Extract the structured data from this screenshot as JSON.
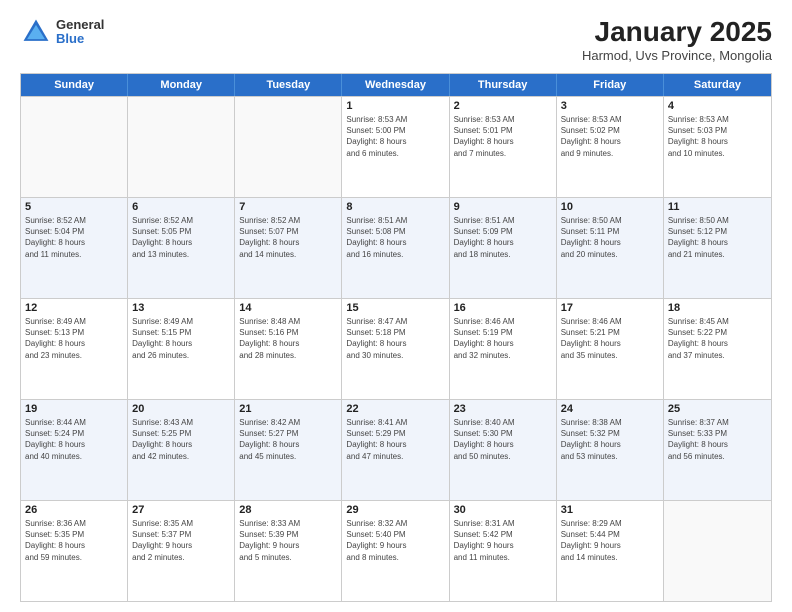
{
  "logo": {
    "general": "General",
    "blue": "Blue"
  },
  "title": "January 2025",
  "subtitle": "Harmod, Uvs Province, Mongolia",
  "headers": [
    "Sunday",
    "Monday",
    "Tuesday",
    "Wednesday",
    "Thursday",
    "Friday",
    "Saturday"
  ],
  "rows": [
    [
      {
        "day": "",
        "lines": []
      },
      {
        "day": "",
        "lines": []
      },
      {
        "day": "",
        "lines": []
      },
      {
        "day": "1",
        "lines": [
          "Sunrise: 8:53 AM",
          "Sunset: 5:00 PM",
          "Daylight: 8 hours",
          "and 6 minutes."
        ]
      },
      {
        "day": "2",
        "lines": [
          "Sunrise: 8:53 AM",
          "Sunset: 5:01 PM",
          "Daylight: 8 hours",
          "and 7 minutes."
        ]
      },
      {
        "day": "3",
        "lines": [
          "Sunrise: 8:53 AM",
          "Sunset: 5:02 PM",
          "Daylight: 8 hours",
          "and 9 minutes."
        ]
      },
      {
        "day": "4",
        "lines": [
          "Sunrise: 8:53 AM",
          "Sunset: 5:03 PM",
          "Daylight: 8 hours",
          "and 10 minutes."
        ]
      }
    ],
    [
      {
        "day": "5",
        "lines": [
          "Sunrise: 8:52 AM",
          "Sunset: 5:04 PM",
          "Daylight: 8 hours",
          "and 11 minutes."
        ]
      },
      {
        "day": "6",
        "lines": [
          "Sunrise: 8:52 AM",
          "Sunset: 5:05 PM",
          "Daylight: 8 hours",
          "and 13 minutes."
        ]
      },
      {
        "day": "7",
        "lines": [
          "Sunrise: 8:52 AM",
          "Sunset: 5:07 PM",
          "Daylight: 8 hours",
          "and 14 minutes."
        ]
      },
      {
        "day": "8",
        "lines": [
          "Sunrise: 8:51 AM",
          "Sunset: 5:08 PM",
          "Daylight: 8 hours",
          "and 16 minutes."
        ]
      },
      {
        "day": "9",
        "lines": [
          "Sunrise: 8:51 AM",
          "Sunset: 5:09 PM",
          "Daylight: 8 hours",
          "and 18 minutes."
        ]
      },
      {
        "day": "10",
        "lines": [
          "Sunrise: 8:50 AM",
          "Sunset: 5:11 PM",
          "Daylight: 8 hours",
          "and 20 minutes."
        ]
      },
      {
        "day": "11",
        "lines": [
          "Sunrise: 8:50 AM",
          "Sunset: 5:12 PM",
          "Daylight: 8 hours",
          "and 21 minutes."
        ]
      }
    ],
    [
      {
        "day": "12",
        "lines": [
          "Sunrise: 8:49 AM",
          "Sunset: 5:13 PM",
          "Daylight: 8 hours",
          "and 23 minutes."
        ]
      },
      {
        "day": "13",
        "lines": [
          "Sunrise: 8:49 AM",
          "Sunset: 5:15 PM",
          "Daylight: 8 hours",
          "and 26 minutes."
        ]
      },
      {
        "day": "14",
        "lines": [
          "Sunrise: 8:48 AM",
          "Sunset: 5:16 PM",
          "Daylight: 8 hours",
          "and 28 minutes."
        ]
      },
      {
        "day": "15",
        "lines": [
          "Sunrise: 8:47 AM",
          "Sunset: 5:18 PM",
          "Daylight: 8 hours",
          "and 30 minutes."
        ]
      },
      {
        "day": "16",
        "lines": [
          "Sunrise: 8:46 AM",
          "Sunset: 5:19 PM",
          "Daylight: 8 hours",
          "and 32 minutes."
        ]
      },
      {
        "day": "17",
        "lines": [
          "Sunrise: 8:46 AM",
          "Sunset: 5:21 PM",
          "Daylight: 8 hours",
          "and 35 minutes."
        ]
      },
      {
        "day": "18",
        "lines": [
          "Sunrise: 8:45 AM",
          "Sunset: 5:22 PM",
          "Daylight: 8 hours",
          "and 37 minutes."
        ]
      }
    ],
    [
      {
        "day": "19",
        "lines": [
          "Sunrise: 8:44 AM",
          "Sunset: 5:24 PM",
          "Daylight: 8 hours",
          "and 40 minutes."
        ]
      },
      {
        "day": "20",
        "lines": [
          "Sunrise: 8:43 AM",
          "Sunset: 5:25 PM",
          "Daylight: 8 hours",
          "and 42 minutes."
        ]
      },
      {
        "day": "21",
        "lines": [
          "Sunrise: 8:42 AM",
          "Sunset: 5:27 PM",
          "Daylight: 8 hours",
          "and 45 minutes."
        ]
      },
      {
        "day": "22",
        "lines": [
          "Sunrise: 8:41 AM",
          "Sunset: 5:29 PM",
          "Daylight: 8 hours",
          "and 47 minutes."
        ]
      },
      {
        "day": "23",
        "lines": [
          "Sunrise: 8:40 AM",
          "Sunset: 5:30 PM",
          "Daylight: 8 hours",
          "and 50 minutes."
        ]
      },
      {
        "day": "24",
        "lines": [
          "Sunrise: 8:38 AM",
          "Sunset: 5:32 PM",
          "Daylight: 8 hours",
          "and 53 minutes."
        ]
      },
      {
        "day": "25",
        "lines": [
          "Sunrise: 8:37 AM",
          "Sunset: 5:33 PM",
          "Daylight: 8 hours",
          "and 56 minutes."
        ]
      }
    ],
    [
      {
        "day": "26",
        "lines": [
          "Sunrise: 8:36 AM",
          "Sunset: 5:35 PM",
          "Daylight: 8 hours",
          "and 59 minutes."
        ]
      },
      {
        "day": "27",
        "lines": [
          "Sunrise: 8:35 AM",
          "Sunset: 5:37 PM",
          "Daylight: 9 hours",
          "and 2 minutes."
        ]
      },
      {
        "day": "28",
        "lines": [
          "Sunrise: 8:33 AM",
          "Sunset: 5:39 PM",
          "Daylight: 9 hours",
          "and 5 minutes."
        ]
      },
      {
        "day": "29",
        "lines": [
          "Sunrise: 8:32 AM",
          "Sunset: 5:40 PM",
          "Daylight: 9 hours",
          "and 8 minutes."
        ]
      },
      {
        "day": "30",
        "lines": [
          "Sunrise: 8:31 AM",
          "Sunset: 5:42 PM",
          "Daylight: 9 hours",
          "and 11 minutes."
        ]
      },
      {
        "day": "31",
        "lines": [
          "Sunrise: 8:29 AM",
          "Sunset: 5:44 PM",
          "Daylight: 9 hours",
          "and 14 minutes."
        ]
      },
      {
        "day": "",
        "lines": []
      }
    ]
  ]
}
